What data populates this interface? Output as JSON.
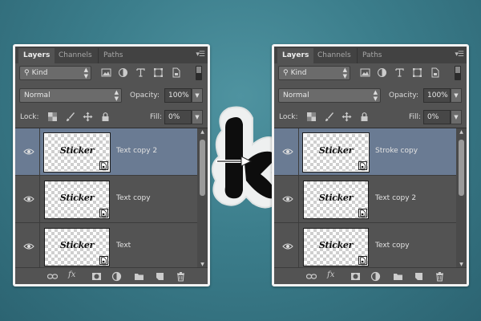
{
  "panels": [
    {
      "id": "left",
      "tabs": [
        "Layers",
        "Channels",
        "Paths"
      ],
      "filter": {
        "value": "Kind"
      },
      "blend_mode": "Normal",
      "opacity_label": "Opacity:",
      "opacity_value": "100%",
      "lock_label": "Lock:",
      "fill_label": "Fill:",
      "fill_value": "0%",
      "layers": [
        {
          "name": "Text copy 2",
          "thumb_text": "Sticker",
          "selected": true
        },
        {
          "name": "Text copy",
          "thumb_text": "Sticker",
          "selected": false
        },
        {
          "name": "Text",
          "thumb_text": "Sticker",
          "selected": false
        }
      ]
    },
    {
      "id": "right",
      "tabs": [
        "Layers",
        "Channels",
        "Paths"
      ],
      "filter": {
        "value": "Kind"
      },
      "blend_mode": "Normal",
      "opacity_label": "Opacity:",
      "opacity_value": "100%",
      "lock_label": "Lock:",
      "fill_label": "Fill:",
      "fill_value": "0%",
      "layers": [
        {
          "name": "Stroke copy",
          "thumb_text": "Sticker",
          "selected": true
        },
        {
          "name": "Text copy 2",
          "thumb_text": "Sticker",
          "selected": false
        },
        {
          "name": "Text copy",
          "thumb_text": "Sticker",
          "selected": false
        }
      ]
    }
  ],
  "bottom_bar_fx": "fx",
  "colors": {
    "background": "#3b7d8b",
    "panel": "#535353",
    "tabbar": "#424242",
    "selected_layer": "#6a7b93",
    "panel_border": "#f3f3f3"
  }
}
